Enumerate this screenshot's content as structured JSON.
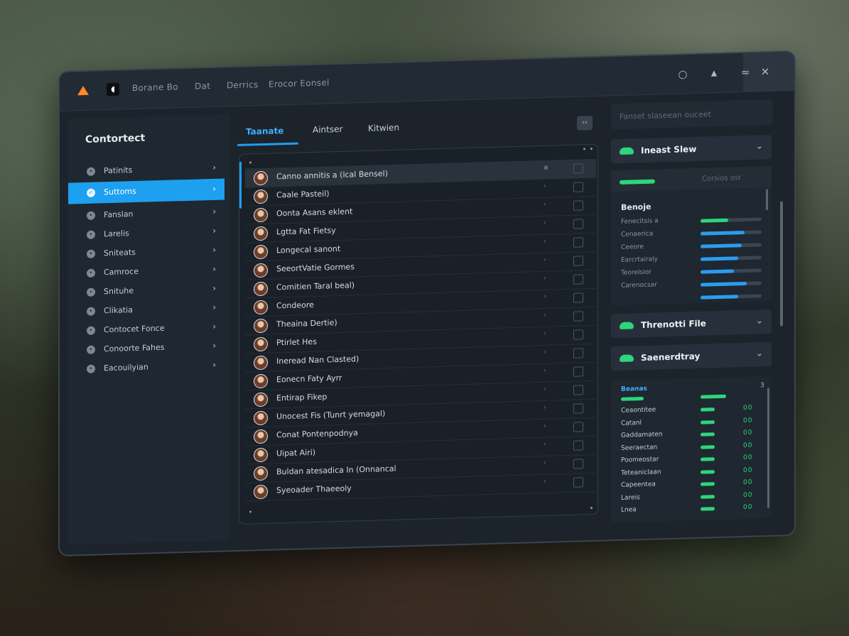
{
  "titlebar": {
    "menu": [
      "Borane Bo",
      "Dat",
      "Derrics",
      "Erocor Eonsel"
    ]
  },
  "sidebar": {
    "title": "Contortect",
    "items": [
      {
        "label": "Patinits"
      },
      {
        "label": "Suttoms"
      },
      {
        "label": "Fanslan"
      },
      {
        "label": "Larelis"
      },
      {
        "label": "Sniteats"
      },
      {
        "label": "Camroce"
      },
      {
        "label": "Snituhe"
      },
      {
        "label": "Clikatia"
      },
      {
        "label": "Contocet Fonce"
      },
      {
        "label": "Conoorte Fahes"
      },
      {
        "label": "Eacouilyian"
      }
    ]
  },
  "tabs": [
    {
      "label": "Taanate"
    },
    {
      "label": "Aintser"
    },
    {
      "label": "Kitwien"
    }
  ],
  "list": {
    "rows": [
      "Canno annitis a (lcal Bensel)",
      "Caale Pasteil)",
      "Oonta Asans eklent",
      "Lgtta Fat Fietsy",
      "Longecal sanont",
      "SeeortVatie Gormes",
      "Comitien Taral beal)",
      "Condeore",
      "Theaina Dertie)",
      "Ptirlet Hes",
      "Ineread Nan Clasted)",
      "Eonecn Faty Ayrr",
      "Entirap Fikep",
      "Unocest Fis (Tunrt yemagal)",
      "Conat Pontenpodnya",
      "Uipat Airi)",
      "Buldan atesadica In (Onnancal",
      "Syeoader Thaeeoly"
    ]
  },
  "right": {
    "search_placeholder": "Fanset slaseean ouceet",
    "accordions": [
      "Ineast Slew",
      "Threnotti File",
      "Saenerdtray"
    ],
    "stats": {
      "header_label": "Corsios osr",
      "title": "Benoje",
      "rows": [
        {
          "label": "Fenecitsis a",
          "value": 0.45,
          "color": "#2fd57a"
        },
        {
          "label": "Cenaerica",
          "value": 0.72,
          "color": "#2a9df0"
        },
        {
          "label": "Ceeore",
          "value": 0.68,
          "color": "#2a9df0"
        },
        {
          "label": "Earcrtairaly",
          "value": 0.62,
          "color": "#2a9df0"
        },
        {
          "label": "Teorelsior",
          "value": 0.55,
          "color": "#2a9df0"
        },
        {
          "label": "Carenocsar",
          "value": 0.75,
          "color": "#2a9df0"
        },
        {
          "label": "",
          "value": 0.62,
          "color": "#2a9df0"
        }
      ]
    },
    "bottom": {
      "title": "Beanas",
      "count": "3",
      "rows": [
        {
          "label": "Ceaontitee",
          "dots": "00"
        },
        {
          "label": "Catanl",
          "dots": "00"
        },
        {
          "label": "Gaddamaten",
          "dots": "00"
        },
        {
          "label": "Seeraectan",
          "dots": "00"
        },
        {
          "label": "Poomeostar",
          "dots": "00"
        },
        {
          "label": "Teteaniclaan",
          "dots": "00"
        },
        {
          "label": "Capeentea",
          "dots": "00"
        },
        {
          "label": "Lareis",
          "dots": "00"
        },
        {
          "label": "Lnea",
          "dots": "00"
        }
      ]
    }
  }
}
